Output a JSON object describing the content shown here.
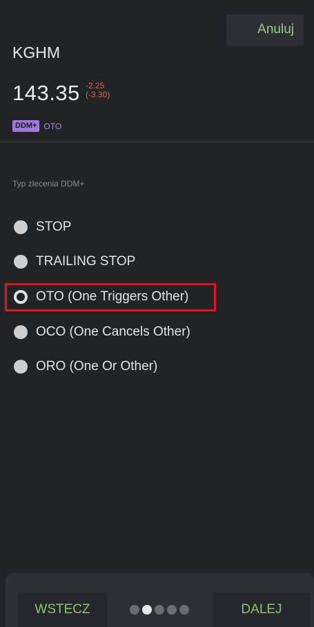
{
  "header": {
    "cancel_label": "Anuluj",
    "ticker": "KGHM",
    "price": "143.35",
    "change_abs": "-2.25",
    "change_pct": "(-3.30)",
    "badge_ddm": "DDM+",
    "badge_order": "OTO"
  },
  "section_label": "Typ zlecenia DDM+",
  "options": [
    {
      "label": "STOP",
      "selected": false
    },
    {
      "label": "TRAILING STOP",
      "selected": false
    },
    {
      "label": "OTO (One Triggers Other)",
      "selected": true
    },
    {
      "label": "OCO (One Cancels Other)",
      "selected": false
    },
    {
      "label": "ORO (One Or Other)",
      "selected": false
    }
  ],
  "footer": {
    "back_label": "WSTECZ",
    "next_label": "DALEJ",
    "page_dots_total": 5,
    "page_dot_active": 2
  },
  "colors": {
    "background": "#212427",
    "accent_green": "#8cc46c",
    "negative_red": "#ef5c48",
    "badge_purple": "#a07ad8",
    "highlight_red": "#e3141f"
  }
}
